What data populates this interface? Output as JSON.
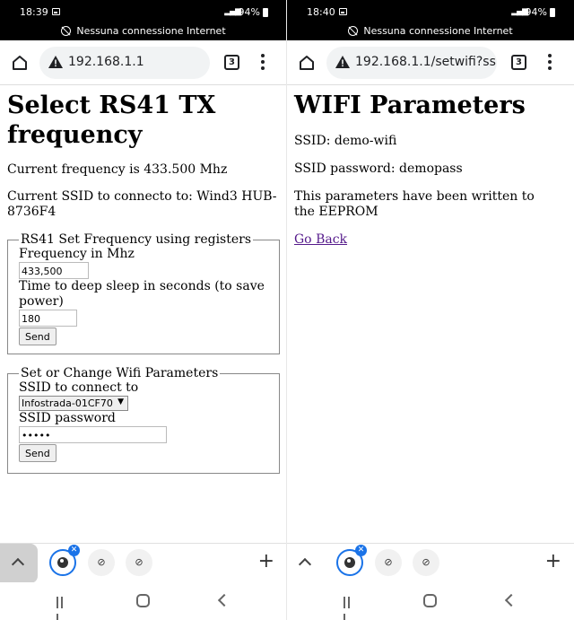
{
  "left": {
    "status": {
      "time": "18:39",
      "battery": "94%"
    },
    "network_banner": "Nessuna connessione Internet",
    "url": "192.168.1.1",
    "tab_count": "3",
    "page": {
      "title": "Select RS41 TX frequency",
      "current_frequency": "Current frequency is 433.500 Mhz",
      "current_ssid": "Current SSID to connecto to: Wind3 HUB-8736F4",
      "freq_form": {
        "legend": "RS41 Set Frequency using registers",
        "freq_label": "Frequency in Mhz",
        "freq_value": "433,500",
        "sleep_label": "Time to deep sleep in seconds (to save power)",
        "sleep_value": "180",
        "send_label": "Send"
      },
      "wifi_form": {
        "legend": "Set or Change Wifi Parameters",
        "ssid_label": "SSID to connect to",
        "ssid_selected": "Infostrada-01CF70",
        "password_label": "SSID password",
        "password_value": "•••••",
        "send_label": "Send"
      }
    }
  },
  "right": {
    "status": {
      "time": "18:40",
      "battery": "94%"
    },
    "network_banner": "Nessuna connessione Internet",
    "url": "192.168.1.1/setwifi?ss",
    "tab_count": "3",
    "page": {
      "title": "WIFI Parameters",
      "ssid": "SSID: demo-wifi",
      "password": "SSID password: demopass",
      "note": "This parameters have been written to the EEPROM",
      "back_link": "Go Back"
    }
  },
  "colors": {
    "accent": "#1a73e8",
    "visited_link": "#551a8b",
    "statusbar": "#000000"
  }
}
